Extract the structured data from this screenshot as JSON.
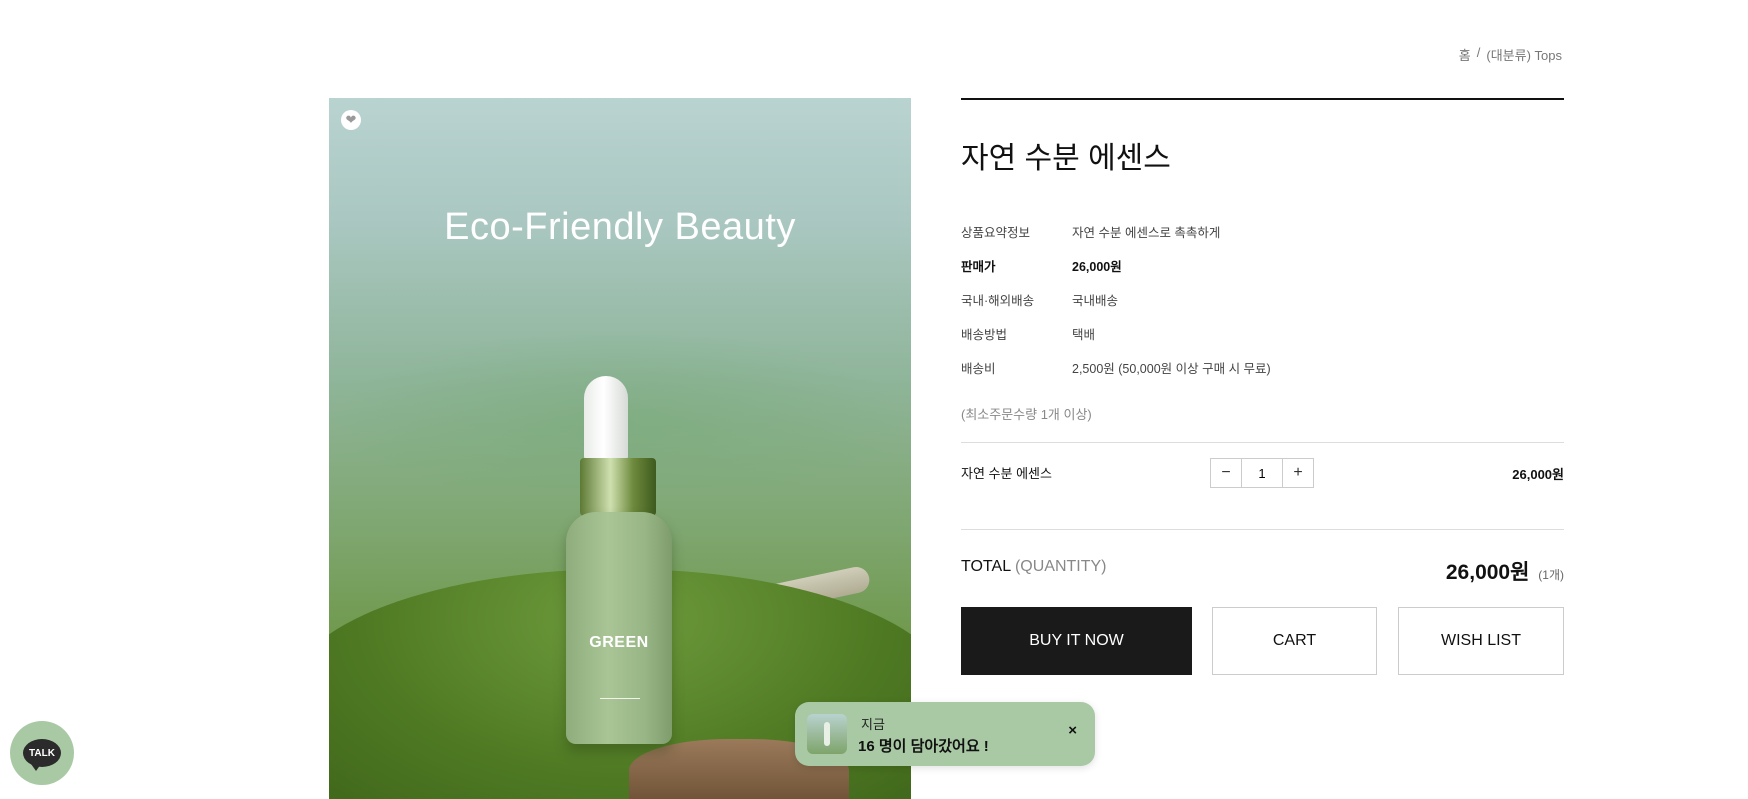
{
  "breadcrumb": {
    "home": "홈",
    "separator": "/",
    "category": "(대분류) Tops"
  },
  "product_image": {
    "headline": "Eco-Friendly Beauty",
    "bottle_brand": "GREEN",
    "like_icon": "heart-icon"
  },
  "product": {
    "title": "자연 수분 에센스",
    "specs": [
      {
        "label": "상품요약정보",
        "value": "자연 수분 에센스로 촉촉하게"
      },
      {
        "label": "판매가",
        "value": "26,000원"
      },
      {
        "label": "국내·해외배송",
        "value": "국내배송"
      },
      {
        "label": "배송방법",
        "value": "택배"
      },
      {
        "label": "배송비",
        "value": "2,500원 (50,000원 이상 구매 시 무료)"
      }
    ],
    "min_qty_note": "(최소주문수량 1개 이상)",
    "option": {
      "name": "자연 수분 에센스",
      "quantity": "1",
      "minus": "−",
      "plus": "+",
      "price": "26,000원"
    },
    "total": {
      "label": "TOTAL",
      "label_sub": "(QUANTITY)",
      "amount": "26,000원",
      "count": "(1개)"
    },
    "buttons": {
      "buy": "BUY IT NOW",
      "cart": "CART",
      "wish": "WISH LIST"
    }
  },
  "toast": {
    "line1": "지금",
    "line2": "16 명이 담아갔어요 !",
    "close": "×"
  },
  "talk": {
    "label": "TALK"
  },
  "colors": {
    "accent_green": "#a8c9a4",
    "primary_dark": "#1a1a1a"
  }
}
